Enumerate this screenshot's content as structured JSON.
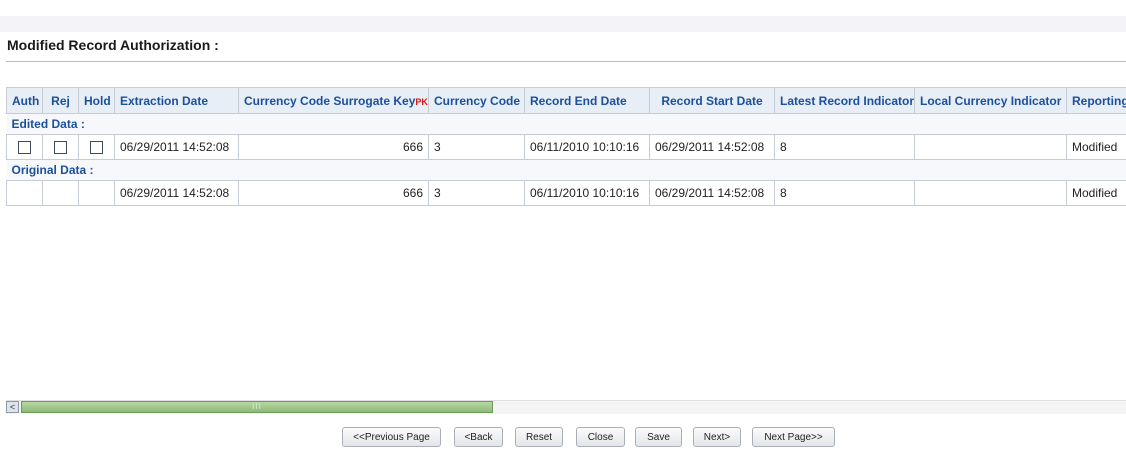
{
  "page": {
    "title": "Modified Record Authorization :"
  },
  "grid": {
    "columns": [
      "Auth",
      "Rej",
      "Hold",
      "Extraction Date",
      "Currency Code Surrogate Key",
      "Currency Code",
      "Record End Date",
      "Record Start Date",
      "Latest Record Indicator",
      "Local Currency Indicator",
      "Reporting Currency"
    ],
    "pk_marker": "PK",
    "edited_label": "Edited Data :",
    "original_label": "Original Data :",
    "edited_row": {
      "extraction_date": "06/29/2011 14:52:08",
      "surrogate_key": "666",
      "currency_code": "3",
      "record_end_date": "06/11/2010 10:10:16",
      "record_start_date": "06/29/2011 14:52:08",
      "latest_record_indicator": "8",
      "local_currency_indicator": "",
      "reporting": "Modified"
    },
    "original_row": {
      "extraction_date": "06/29/2011 14:52:08",
      "surrogate_key": "666",
      "currency_code": "3",
      "record_end_date": "06/11/2010 10:10:16",
      "record_start_date": "06/29/2011 14:52:08",
      "latest_record_indicator": "8",
      "local_currency_indicator": "",
      "reporting": "Modified"
    }
  },
  "scrollbar": {
    "left_arrow": "<",
    "thumb_grip": "III"
  },
  "buttons": {
    "previous_page": "<<Previous Page",
    "back": "<Back",
    "reset": "Reset",
    "close": "Close",
    "save": "Save",
    "next": "Next>",
    "next_page": "Next Page>>"
  },
  "colors": {
    "header_text": "#1c4f9c",
    "header_bg": "#e8eef6",
    "pk_marker": "#d41515",
    "scroll_thumb": "#8fba78"
  }
}
